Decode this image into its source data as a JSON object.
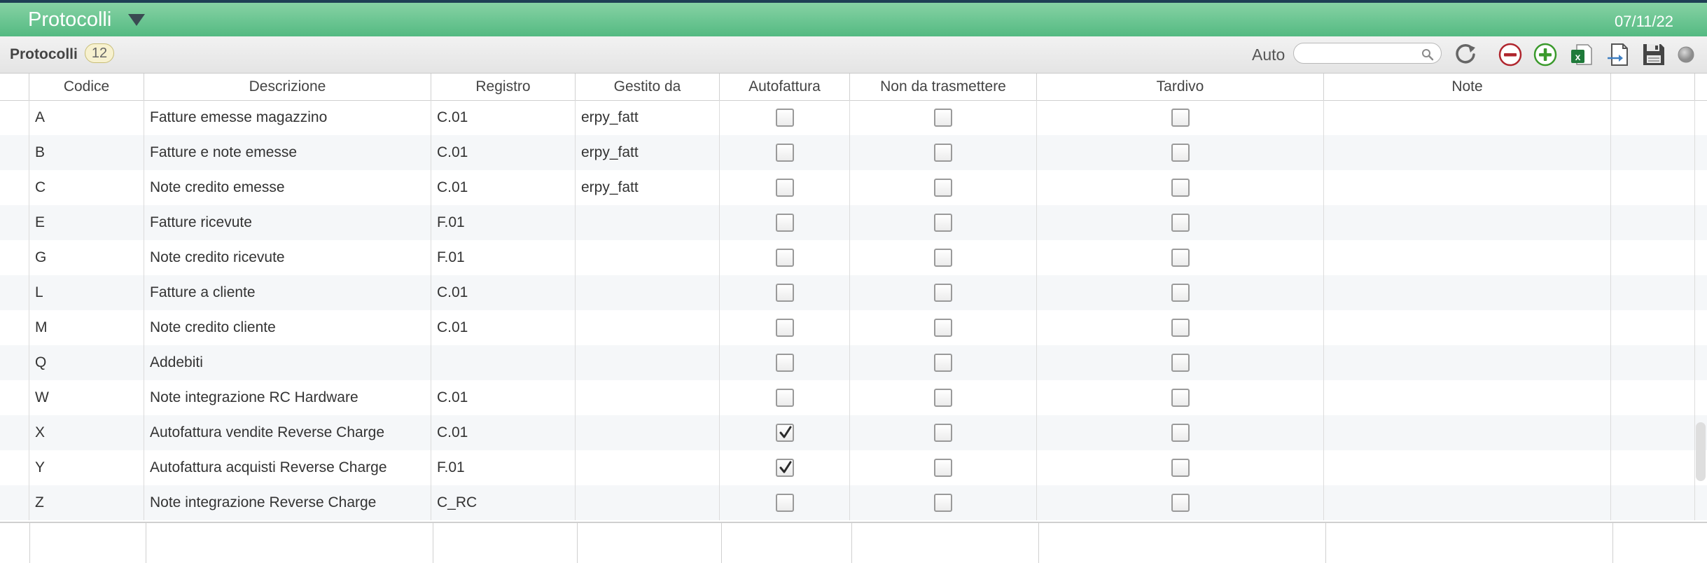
{
  "header": {
    "title": "Protocolli",
    "date": "07/11/22"
  },
  "toolbar": {
    "title": "Protocolli",
    "count": "12",
    "auto_label": "Auto",
    "search_value": "",
    "search_placeholder": ""
  },
  "columns": [
    "Codice",
    "Descrizione",
    "Registro",
    "Gestito da",
    "Autofattura",
    "Non da trasmettere",
    "Tardivo",
    "Note"
  ],
  "rows": [
    {
      "codice": "A",
      "descrizione": "Fatture emesse magazzino",
      "registro": "C.01",
      "gestito_da": "erpy_fatt",
      "autofattura": false,
      "non_da_trasmettere": false,
      "tardivo": false,
      "note": ""
    },
    {
      "codice": "B",
      "descrizione": "Fatture e note emesse",
      "registro": "C.01",
      "gestito_da": "erpy_fatt",
      "autofattura": false,
      "non_da_trasmettere": false,
      "tardivo": false,
      "note": ""
    },
    {
      "codice": "C",
      "descrizione": "Note credito emesse",
      "registro": "C.01",
      "gestito_da": "erpy_fatt",
      "autofattura": false,
      "non_da_trasmettere": false,
      "tardivo": false,
      "note": ""
    },
    {
      "codice": "E",
      "descrizione": "Fatture ricevute",
      "registro": "F.01",
      "gestito_da": "",
      "autofattura": false,
      "non_da_trasmettere": false,
      "tardivo": false,
      "note": ""
    },
    {
      "codice": "G",
      "descrizione": "Note credito ricevute",
      "registro": "F.01",
      "gestito_da": "",
      "autofattura": false,
      "non_da_trasmettere": false,
      "tardivo": false,
      "note": ""
    },
    {
      "codice": "L",
      "descrizione": "Fatture a cliente",
      "registro": "C.01",
      "gestito_da": "",
      "autofattura": false,
      "non_da_trasmettere": false,
      "tardivo": false,
      "note": ""
    },
    {
      "codice": "M",
      "descrizione": "Note credito cliente",
      "registro": "C.01",
      "gestito_da": "",
      "autofattura": false,
      "non_da_trasmettere": false,
      "tardivo": false,
      "note": ""
    },
    {
      "codice": "Q",
      "descrizione": "Addebiti",
      "registro": "",
      "gestito_da": "",
      "autofattura": false,
      "non_da_trasmettere": false,
      "tardivo": false,
      "note": ""
    },
    {
      "codice": "W",
      "descrizione": "Note integrazione RC Hardware",
      "registro": "C.01",
      "gestito_da": "",
      "autofattura": false,
      "non_da_trasmettere": false,
      "tardivo": false,
      "note": ""
    },
    {
      "codice": "X",
      "descrizione": "Autofattura vendite Reverse Charge",
      "registro": "C.01",
      "gestito_da": "",
      "autofattura": true,
      "non_da_trasmettere": false,
      "tardivo": false,
      "note": ""
    },
    {
      "codice": "Y",
      "descrizione": "Autofattura acquisti Reverse Charge",
      "registro": "F.01",
      "gestito_da": "",
      "autofattura": true,
      "non_da_trasmettere": false,
      "tardivo": false,
      "note": ""
    },
    {
      "codice": "Z",
      "descrizione": "Note integrazione Reverse Charge",
      "registro": "C_RC",
      "gestito_da": "",
      "autofattura": false,
      "non_da_trasmettere": false,
      "tardivo": false,
      "note": ""
    }
  ],
  "icons": {
    "menu_caret": "caret-down-icon",
    "search": "magnifier-icon",
    "reload": "reload-icon",
    "remove": "minus-circle-icon",
    "add": "plus-circle-icon",
    "export": "excel-icon",
    "import": "import-icon",
    "save": "floppy-disk-icon",
    "status": "status-dot-icon",
    "check": "checkmark-icon"
  },
  "colors": {
    "header_green": "#54ba82",
    "remove_red": "#b0262e",
    "add_green": "#3b9a2c",
    "excel_green": "#1f7a3a"
  }
}
